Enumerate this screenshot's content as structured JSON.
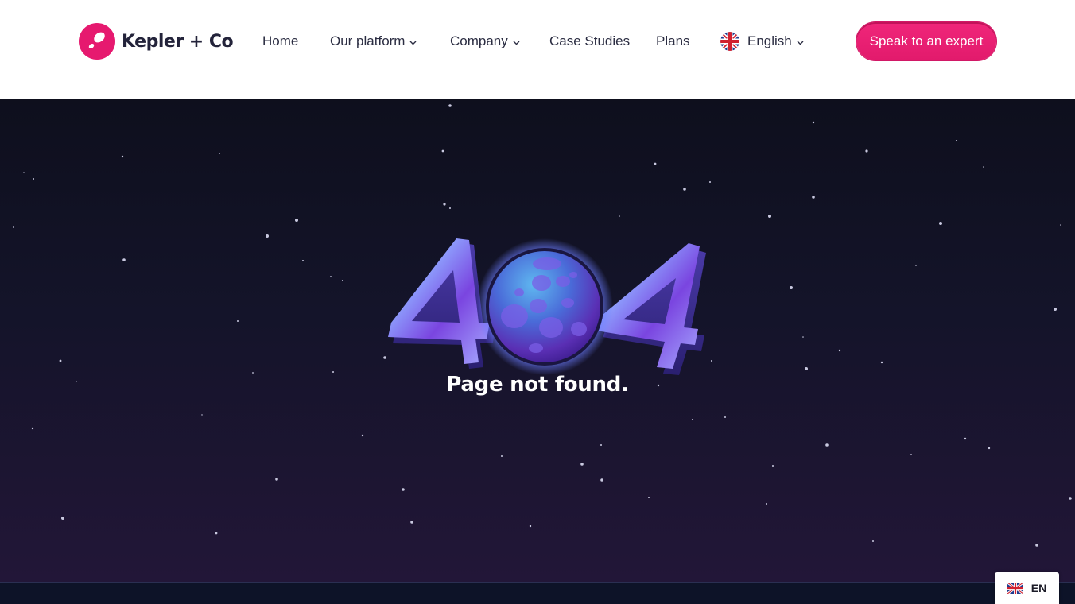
{
  "brand": {
    "name": "Kepler + Co",
    "color": "#e6196f"
  },
  "nav": {
    "home": "Home",
    "platform": "Our platform",
    "company": "Company",
    "case_studies": "Case Studies",
    "plans": "Plans",
    "language": "English"
  },
  "cta": {
    "label": "Speak to an expert"
  },
  "hero": {
    "error_code": "404",
    "message": "Page not found."
  },
  "language_widget": {
    "code": "EN"
  },
  "icons": {
    "logo": "kepler-logo-icon",
    "dropdown": "chevron-down-icon",
    "flag": "uk-flag-icon",
    "planet": "planet-icon"
  }
}
